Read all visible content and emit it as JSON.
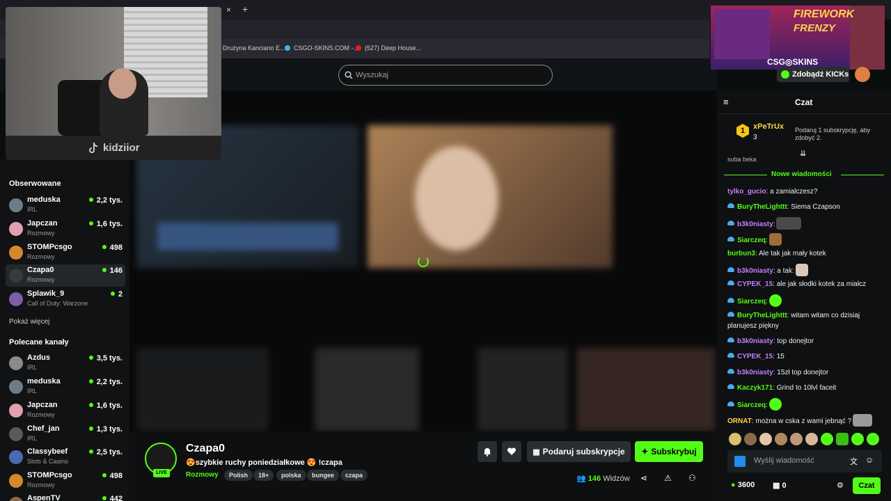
{
  "browser": {
    "new_tab": "+",
    "close_tab": "×",
    "bookmarks": [
      {
        "label": "Drużyna Kanciano E...",
        "color": "#3a3a3a"
      },
      {
        "label": "CSGO-SKINS.COM -...",
        "color": "#3fb8e6"
      },
      {
        "label": "(527) Deep House...",
        "color": "#e02020"
      }
    ]
  },
  "search": {
    "placeholder": "Wyszukaj"
  },
  "webcam": {
    "tag": "kidziior"
  },
  "sidebar": {
    "followed_title": "Obserwowane",
    "followed": [
      {
        "name": "meduska",
        "category": "IRL",
        "viewers": "2,2 tys.",
        "color": "#6d7c86"
      },
      {
        "name": "Japczan",
        "category": "Rozmowy",
        "viewers": "1,6 tys.",
        "color": "#e0a0b0"
      },
      {
        "name": "STOMPcsgo",
        "category": "Rozmowy",
        "viewers": "498",
        "color": "#d58a2a"
      },
      {
        "name": "Czapa0",
        "category": "Rozmowy",
        "viewers": "146",
        "color": "#3a3a3a"
      },
      {
        "name": "Splawik_9",
        "category": "Call of Duty: Warzone",
        "viewers": "2",
        "color": "#7a5ea8"
      }
    ],
    "show_more": "Pokaż więcej",
    "recommended_title": "Polecane kanały",
    "recommended": [
      {
        "name": "Azdus",
        "category": "IRL",
        "viewers": "3,5 tys.",
        "color": "#8a8a8a"
      },
      {
        "name": "meduska",
        "category": "IRL",
        "viewers": "2,2 tys.",
        "color": "#6d7c86"
      },
      {
        "name": "Japczan",
        "category": "Rozmowy",
        "viewers": "1,6 tys.",
        "color": "#e0a0b0"
      },
      {
        "name": "Chef_jan",
        "category": "IRL",
        "viewers": "1,3 tys.",
        "color": "#5a5a5a"
      },
      {
        "name": "Classybeef",
        "category": "Slots & Casino",
        "viewers": "2,5 tys.",
        "color": "#4a6ab8"
      },
      {
        "name": "STOMPcsgo",
        "category": "Rozmowy",
        "viewers": "498",
        "color": "#d58a2a"
      },
      {
        "name": "AspenTV",
        "category": "",
        "viewers": "442",
        "color": "#8a6a4a"
      }
    ]
  },
  "stream": {
    "name": "Czapa0",
    "live": "LIVE",
    "title": "😍szybkie ruchy poniedziałkowe 😍 !czapa",
    "category": "Rozmowy",
    "tags": [
      "Polish",
      "18+",
      "polska",
      "bungee",
      "czapa"
    ],
    "gift_label": "Podaruj subskrypcje",
    "subscribe_label": "Subskrybuj",
    "viewers_count": "146",
    "viewers_label": "Widzów"
  },
  "chat": {
    "title": "Czat",
    "pinned": {
      "user": "xPeTrUx",
      "rank": "1",
      "count": "3",
      "text": "Podaruj 1 subskrypcję, aby zdobyć 2."
    },
    "cut_line": "suba beka",
    "new_messages": "Nowe wiadomości",
    "messages": [
      {
        "user": "tylko_gucio",
        "color": "#c77dff",
        "badge": false,
        "text": ": a zamialczesz?"
      },
      {
        "user": "BuryTheLighttt",
        "color": "#53fc18",
        "badge": true,
        "text": ": Siema Czapson"
      },
      {
        "user": "b3k0niasty",
        "color": "#c77dff",
        "badge": true,
        "text": ":"
      },
      {
        "user": "Siarczeq",
        "color": "#53fc18",
        "badge": true,
        "text": ":"
      },
      {
        "user": "burbun3",
        "color": "#53fc18",
        "badge": false,
        "text": ": Ale tak jak mały kotek"
      },
      {
        "user": "b3k0niasty",
        "color": "#c77dff",
        "badge": true,
        "text": ": a      tak:"
      },
      {
        "user": "CYPEK_15",
        "color": "#c77dff",
        "badge": true,
        "text": ": ale jak słodki kotek za miałcz"
      },
      {
        "user": "Siarczeq",
        "color": "#53fc18",
        "badge": true,
        "text": ":"
      },
      {
        "user": "BuryTheLighttt",
        "color": "#53fc18",
        "badge": true,
        "text": ": witam witam co dzisiaj planujesz piękny"
      },
      {
        "user": "b3k0niasty",
        "color": "#c77dff",
        "badge": true,
        "text": ": top donejtor"
      },
      {
        "user": "CYPEK_15",
        "color": "#c77dff",
        "badge": true,
        "text": ": 15"
      },
      {
        "user": "b3k0niasty",
        "color": "#c77dff",
        "badge": true,
        "text": ": 15zł top donejtor"
      },
      {
        "user": "Kaczyk171",
        "color": "#53fc18",
        "badge": true,
        "text": ": Grind to 10lvl faceit"
      },
      {
        "user": "Siarczeq",
        "color": "#53fc18",
        "badge": true,
        "text": ":"
      },
      {
        "user": "ORNAT",
        "color": "#ffd34a",
        "badge": false,
        "text": ": można w cska z wami jebnąć ?"
      }
    ],
    "input_placeholder": "Wyślij wiadomość",
    "points": "3600",
    "count2": "0",
    "send_label": "Czat"
  },
  "ad": {
    "line1": "FIREWORK",
    "line2": "FRENZY",
    "brand": "CSG◎SKINS",
    "kicks_label": "Zdobądź KICKs"
  }
}
